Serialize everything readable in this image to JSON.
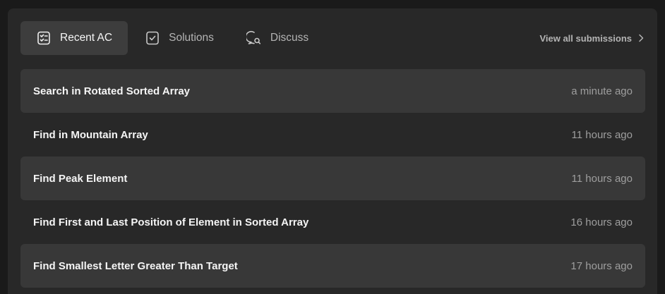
{
  "tabs": [
    {
      "label": "Recent AC",
      "icon": "checklist-icon",
      "active": true
    },
    {
      "label": "Solutions",
      "icon": "checkbox-icon",
      "active": false
    },
    {
      "label": "Discuss",
      "icon": "discuss-icon",
      "active": false
    }
  ],
  "view_all_label": "View all submissions",
  "submissions": [
    {
      "title": "Search in Rotated Sorted Array",
      "time": "a minute ago"
    },
    {
      "title": "Find in Mountain Array",
      "time": "11 hours ago"
    },
    {
      "title": "Find Peak Element",
      "time": "11 hours ago"
    },
    {
      "title": "Find First and Last Position of Element in Sorted Array",
      "time": "16 hours ago"
    },
    {
      "title": "Find Smallest Letter Greater Than Target",
      "time": "17 hours ago"
    }
  ],
  "colors": {
    "background": "#1a1a1a",
    "panel": "#282828",
    "row_highlight": "#383838",
    "active_tab": "#3d3d3d"
  }
}
